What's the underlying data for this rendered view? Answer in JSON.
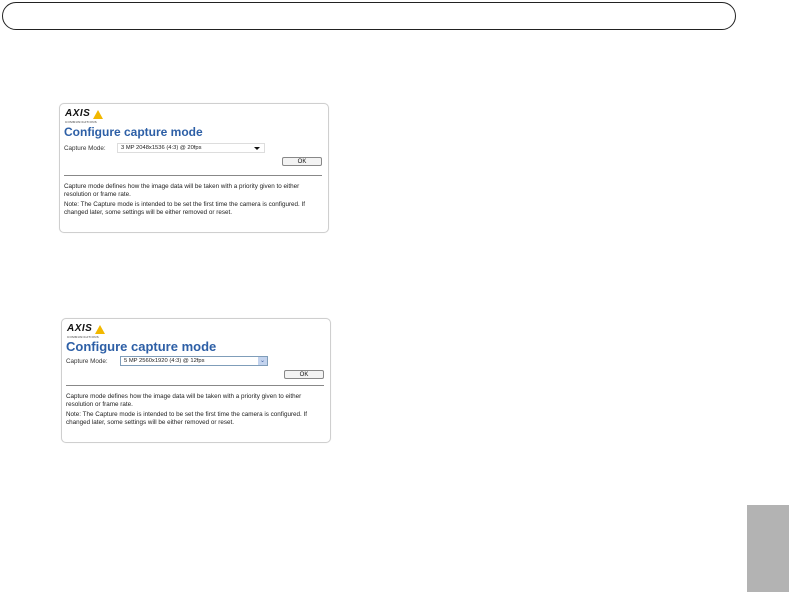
{
  "dialog_1": {
    "logo_text": "AXIS",
    "logo_subtext": "COMMUNICATIONS",
    "title": "Configure capture mode",
    "capture_label": "Capture Mode:",
    "capture_value": "3 MP 2048x1536 (4:3) @ 20fps",
    "ok_label": "OK",
    "description": "Capture mode defines how the image data will be taken with a priority given to either resolution or frame rate.",
    "note": "Note: The Capture mode is intended to be set the first time the camera is configured. If changed later, some settings will be either removed or reset."
  },
  "dialog_2": {
    "logo_text": "AXIS",
    "logo_subtext": "COMMUNICATIONS",
    "title": "Configure capture mode",
    "capture_label": "Capture Mode:",
    "capture_value": "5 MP 2560x1920 (4:3) @ 12fps",
    "ok_label": "OK",
    "description": "Capture mode defines how the image data will be taken with a priority given to either resolution or frame rate.",
    "note": "Note: The Capture mode is intended to be set the first time the camera is configured. If changed later, some settings will be either removed or reset."
  },
  "colors": {
    "title": "#2d5fa6",
    "logo_triangle": "#f2b800",
    "side_tab": "#b3b3b3"
  }
}
